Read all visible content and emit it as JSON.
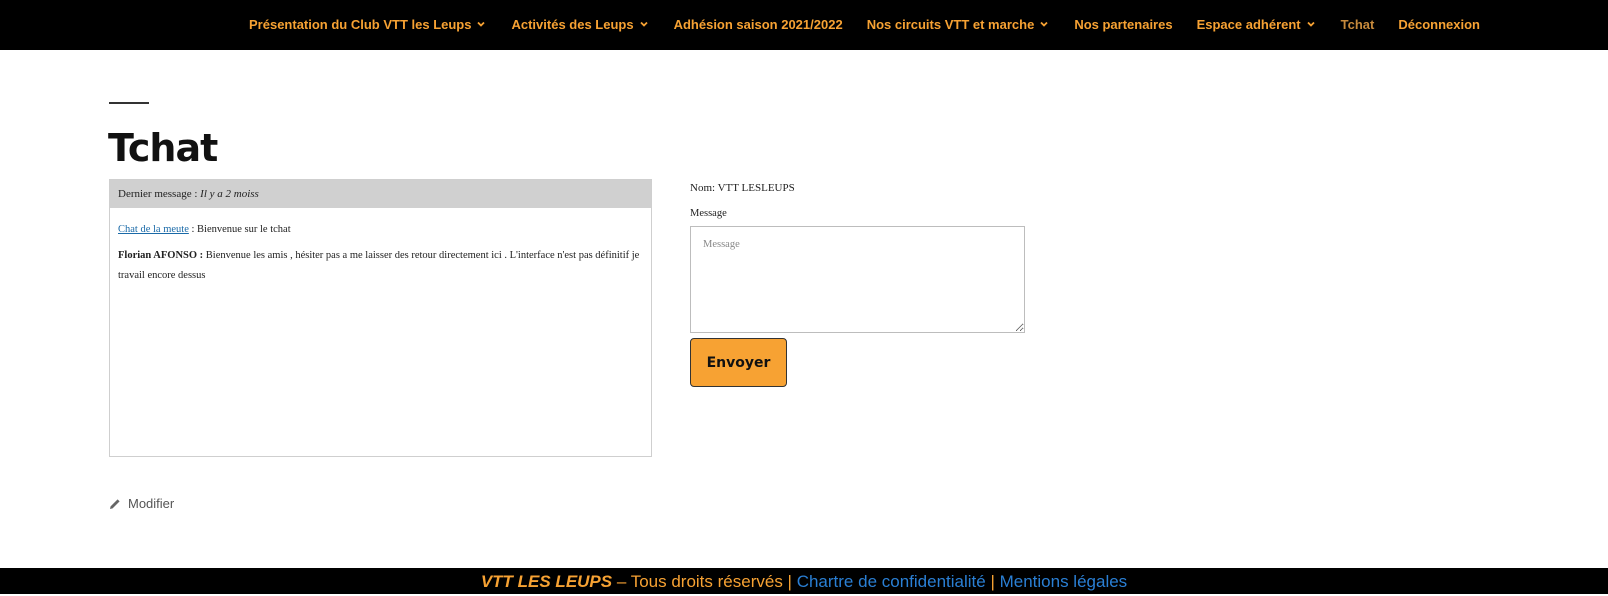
{
  "nav": {
    "items": [
      {
        "label": "Présentation du Club VTT les Leups",
        "has_dropdown": true
      },
      {
        "label": "Activités des Leups",
        "has_dropdown": true
      },
      {
        "label": "Adhésion saison 2021/2022",
        "has_dropdown": false
      },
      {
        "label": "Nos circuits VTT et marche",
        "has_dropdown": true
      },
      {
        "label": "Nos partenaires",
        "has_dropdown": false
      },
      {
        "label": "Espace adhérent",
        "has_dropdown": true
      },
      {
        "label": "Tchat",
        "has_dropdown": false,
        "current": true
      },
      {
        "label": "Déconnexion",
        "has_dropdown": false
      }
    ]
  },
  "page": {
    "title": "Tchat"
  },
  "chat": {
    "header_prefix": "Dernier message :",
    "header_time": "Il y a 2 moiss",
    "messages": [
      {
        "author": "Chat de la meute",
        "author_is_link": true,
        "text": " : Bienvenue sur le tchat"
      },
      {
        "author": "Florian AFONSO :",
        "author_is_link": false,
        "text": " Bienvenue les amis , hésiter pas a me laisser des retour directement ici . L'interface n'est pas définitif je travail encore dessus"
      }
    ]
  },
  "form": {
    "name_line": "Nom: VTT LESLEUPS",
    "message_label": "Message",
    "message_placeholder": "Message",
    "message_value": "",
    "send_label": "Envoyer"
  },
  "edit": {
    "label": "Modifier",
    "icon": "pencil-icon"
  },
  "footer": {
    "brand": "VTT LES LEUPS",
    "rights": " – Tous droits réservés ",
    "sep1": "|",
    "privacy": "Chartre de confidentialité",
    "sep2": "|",
    "legal": "Mentions légales"
  },
  "colors": {
    "accent": "#f7a233",
    "nav_bg": "#000000",
    "link": "#2a7fd4",
    "chat_header_bg": "#d0d0d0"
  }
}
